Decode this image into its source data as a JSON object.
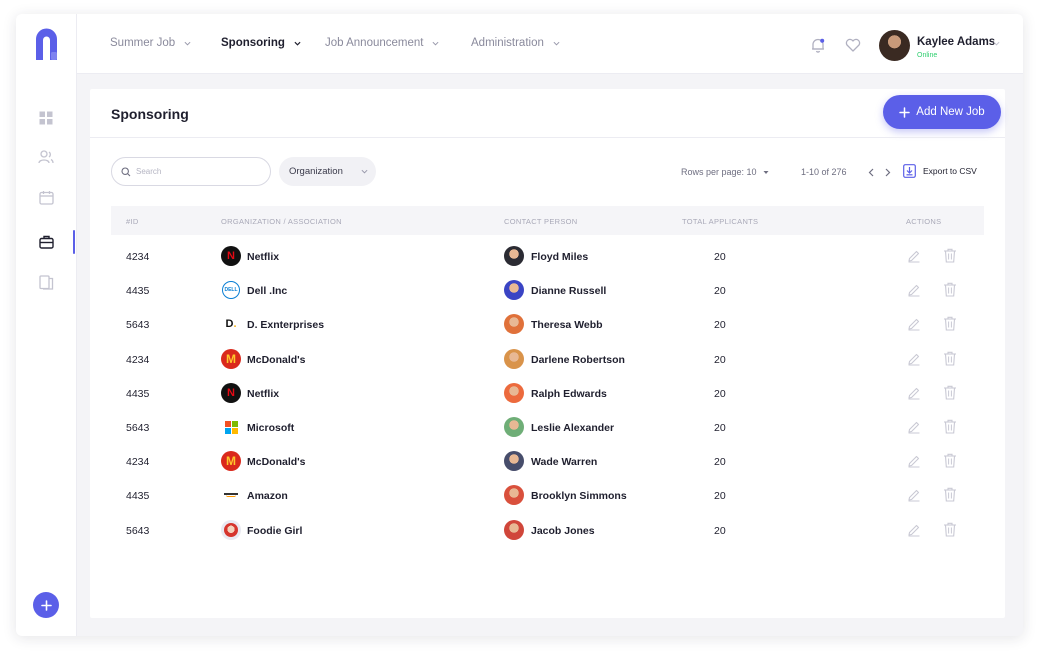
{
  "brand": {
    "accent": "#5b5fe8",
    "online_color": "#2ecf6f"
  },
  "sidebar": {
    "items": [
      {
        "icon": "dashboard-icon"
      },
      {
        "icon": "users-icon"
      },
      {
        "icon": "calendar-icon"
      },
      {
        "icon": "briefcase-icon",
        "active": true
      },
      {
        "icon": "documents-icon"
      }
    ],
    "add_icon": "plus-icon"
  },
  "topnav": {
    "items": [
      {
        "label": "Summer Job"
      },
      {
        "label": "Sponsoring",
        "active": true
      },
      {
        "label": "Job Announcement"
      },
      {
        "label": "Administration"
      }
    ]
  },
  "user": {
    "name": "Kaylee Adams",
    "status": "Online"
  },
  "page": {
    "title": "Sponsoring",
    "add_button": "Add New Job",
    "search_placeholder": "Search",
    "org_filter": "Organization",
    "rows_per_page": "Rows per page: 10",
    "range": "1-10 of 276",
    "export": "Export to CSV"
  },
  "table": {
    "headers": [
      "#ID",
      "ORGANIZATION / ASSOCIATION",
      "CONTACT PERSON",
      "TOTAL APPLICANTS",
      "ACTIONS"
    ],
    "rows": [
      {
        "id": "4234",
        "org": "Netflix",
        "org_logo": "netflix",
        "contact": "Floyd Miles",
        "avatar_color": "#2b2b33",
        "applicants": "20"
      },
      {
        "id": "4435",
        "org": "Dell .Inc",
        "org_logo": "dell",
        "contact": "Dianne Russell",
        "avatar_color": "#3a44c4",
        "applicants": "20"
      },
      {
        "id": "5643",
        "org": "D. Exnterprises",
        "org_logo": "d",
        "contact": "Theresa Webb",
        "avatar_color": "#e0713a",
        "applicants": "20"
      },
      {
        "id": "4234",
        "org": "McDonald's",
        "org_logo": "mcdonalds",
        "contact": "Darlene Robertson",
        "avatar_color": "#d9934a",
        "applicants": "20"
      },
      {
        "id": "4435",
        "org": "Netflix",
        "org_logo": "netflix",
        "contact": "Ralph Edwards",
        "avatar_color": "#ec6a3d",
        "applicants": "20"
      },
      {
        "id": "5643",
        "org": "Microsoft",
        "org_logo": "microsoft",
        "contact": "Leslie Alexander",
        "avatar_color": "#6fae77",
        "applicants": "20"
      },
      {
        "id": "4234",
        "org": "McDonald's",
        "org_logo": "mcdonalds",
        "contact": "Wade Warren",
        "avatar_color": "#474d6b",
        "applicants": "20"
      },
      {
        "id": "4435",
        "org": "Amazon",
        "org_logo": "amazon",
        "contact": "Brooklyn Simmons",
        "avatar_color": "#d9503c",
        "applicants": "20"
      },
      {
        "id": "5643",
        "org": "Foodie Girl",
        "org_logo": "foodie",
        "contact": "Jacob Jones",
        "avatar_color": "#d0463a",
        "applicants": "20"
      }
    ]
  }
}
